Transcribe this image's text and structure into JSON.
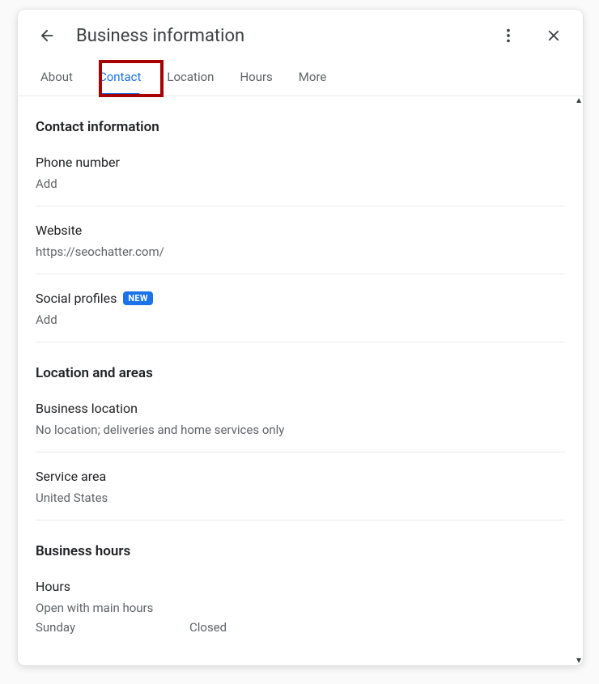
{
  "header": {
    "title": "Business information"
  },
  "tabs": {
    "about": "About",
    "contact": "Contact",
    "location": "Location",
    "hours": "Hours",
    "more": "More"
  },
  "sections": {
    "contact_info": {
      "heading": "Contact information",
      "phone": {
        "label": "Phone number",
        "value": "Add"
      },
      "website": {
        "label": "Website",
        "value": "https://seochatter.com/"
      },
      "social": {
        "label": "Social profiles",
        "badge": "NEW",
        "value": "Add"
      }
    },
    "location_areas": {
      "heading": "Location and areas",
      "business_location": {
        "label": "Business location",
        "value": "No location; deliveries and home services only"
      },
      "service_area": {
        "label": "Service area",
        "value": "United States"
      }
    },
    "business_hours": {
      "heading": "Business hours",
      "hours": {
        "label": "Hours",
        "value": "Open with main hours"
      },
      "rows": [
        {
          "day": "Sunday",
          "status": "Closed"
        }
      ]
    }
  }
}
